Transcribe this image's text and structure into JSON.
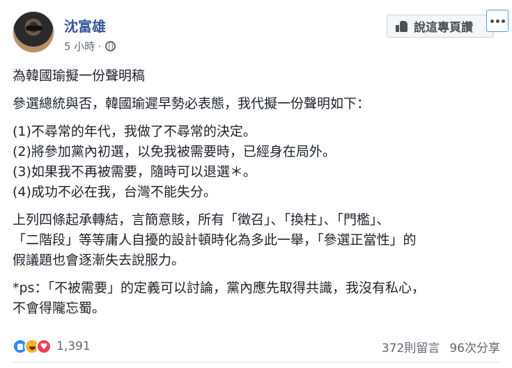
{
  "post": {
    "author": "沈富雄",
    "time": "5 小時",
    "separator": "·",
    "privacy_icon": "globe-icon",
    "like_page_label": "說這專頁讚",
    "more_icon": "more-dots-icon"
  },
  "content": {
    "title": "為韓國瑜擬一份聲明稿",
    "intro": "參選總統與否，韓國瑜遲早勢必表態，我代擬一份聲明如下：",
    "items": [
      "(1)不尋常的年代，我做了不尋常的決定。",
      "(2)將參加黨內初選，以免我被需要時，已經身在局外。",
      "(3)如果我不再被需要，隨時可以退選＊。",
      "(4)成功不必在我，台灣不能失分。"
    ],
    "paragraph3_lines": [
      "上列四條起承轉結，言簡意賅，所有「徵召」、「換柱」、「門檻」、",
      "「二階段」等等庸人自擾的設計頓時化為多此一舉，「參選正當性」的",
      "假議題也會逐漸失去說服力。"
    ],
    "ps_lines": [
      "*ps：「不被需要」的定義可以討論，黨內應先取得共識，我沒有私心，",
      "不會得隴忘蜀。"
    ]
  },
  "footer": {
    "reaction_icons": [
      "like-reaction-icon",
      "haha-reaction-icon",
      "love-reaction-icon"
    ],
    "reaction_count": "1,391",
    "comments": "372則留言",
    "shares": "96次分享"
  },
  "colors": {
    "author_link": "#365899",
    "secondary_text": "#616770",
    "like_reaction": "#2d88ff",
    "love_reaction": "#f33e58",
    "haha_reaction": "#f7b125"
  }
}
